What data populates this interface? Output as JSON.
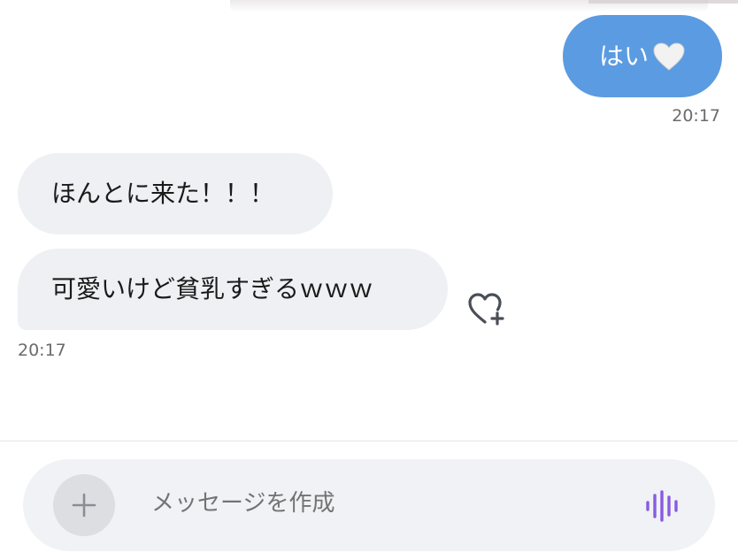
{
  "conversation": {
    "messages": [
      {
        "direction": "outgoing",
        "text": "はい",
        "emoji": "white-heart-icon"
      },
      {
        "direction": "incoming",
        "text": "ほんとに来た！！！"
      },
      {
        "direction": "incoming",
        "text": "可愛いけど貧乳すぎるｗｗｗ"
      }
    ],
    "outgoing_time": "20:17",
    "incoming_time": "20:17"
  },
  "composer": {
    "placeholder": "メッセージを作成",
    "add_icon": "plus-icon",
    "voice_icon": "voice-waveform-icon",
    "react_icon": "heart-add-icon"
  },
  "colors": {
    "outgoing_bubble": "#5b9be1",
    "incoming_bubble": "#eef0f3",
    "voice_accent": "#8a5be0",
    "timestamp": "#6b6b6b"
  }
}
